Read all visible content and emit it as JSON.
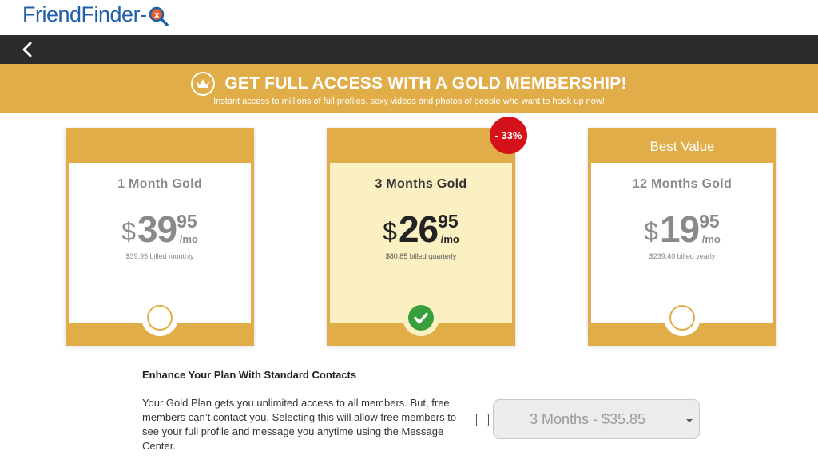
{
  "header": {
    "logo_text": "FriendFinder-"
  },
  "banner": {
    "title": "GET FULL ACCESS WITH A GOLD MEMBERSHIP!",
    "subtitle": "Instant access to millions of full profiles, sexy videos and photos of people who want to hook up now!"
  },
  "plans": [
    {
      "top_label": "",
      "name": "1 Month Gold",
      "dollar": "$",
      "whole": "39",
      "cents": "95",
      "per": "/mo",
      "billed": "$39.95 billed monthly",
      "selected": false
    },
    {
      "top_label": "",
      "name": "3 Months Gold",
      "dollar": "$",
      "whole": "26",
      "cents": "95",
      "per": "/mo",
      "billed": "$80.85 billed quarterly",
      "selected": true
    },
    {
      "top_label": "Best Value",
      "name": "12 Months Gold",
      "dollar": "$",
      "whole": "19",
      "cents": "95",
      "per": "/mo",
      "billed": "$239.40 billed yearly",
      "selected": false
    }
  ],
  "discount_badge": "- 33%",
  "enhance": {
    "title": "Enhance Your Plan With Standard Contacts",
    "description": "Your Gold Plan gets you unlimited access to all members. But, free members can’t contact you. Selecting this will allow free members to see your full profile and message you anytime using the Message Center.",
    "checkbox_checked": false,
    "select_value": "3 Months - $35.85"
  },
  "colors": {
    "gold": "#e1ad48",
    "nav_dark": "#2b2b2b",
    "selected_bg": "#fbf0c1",
    "discount_red": "#d4121b",
    "check_green": "#38a03a",
    "logo_blue": "#1f5fa8"
  }
}
